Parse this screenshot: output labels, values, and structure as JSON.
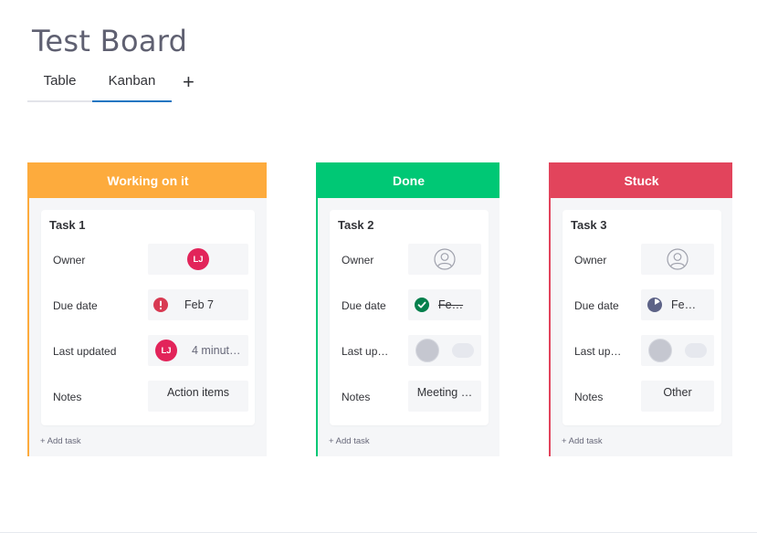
{
  "board": {
    "title": "Test Board"
  },
  "tabs": [
    {
      "label": "Table"
    },
    {
      "label": "Kanban",
      "active": true
    }
  ],
  "tab_add_label": "+",
  "columns": [
    {
      "header": "Working on it",
      "color": "#fdab3d",
      "card": {
        "title": "Task 1",
        "labels": {
          "owner": "Owner",
          "due": "Due date",
          "updated": "Last updated",
          "notes": "Notes"
        },
        "owner_initials": "LJ",
        "due_text": "Feb 7",
        "due_icon": "alert-circle-icon",
        "updated_initials": "LJ",
        "updated_text": "4 minut…",
        "notes_text": "Action items"
      },
      "add_task": "+ Add task"
    },
    {
      "header": "Done",
      "color": "#00c875",
      "card": {
        "title": "Task 2",
        "labels": {
          "owner": "Owner",
          "due": "Due date",
          "updated": "Last up…",
          "notes": "Notes"
        },
        "owner_icon": "person-icon",
        "due_text": "Fe…",
        "due_icon": "check-circle-icon",
        "notes_text": "Meeting …"
      },
      "add_task": "+ Add task"
    },
    {
      "header": "Stuck",
      "color": "#e2445c",
      "card": {
        "title": "Task 3",
        "labels": {
          "owner": "Owner",
          "due": "Due date",
          "updated": "Last up…",
          "notes": "Notes"
        },
        "owner_icon": "person-icon",
        "due_text": "Fe…",
        "due_icon": "clock-icon",
        "notes_text": "Other"
      },
      "add_task": "+ Add task"
    }
  ]
}
